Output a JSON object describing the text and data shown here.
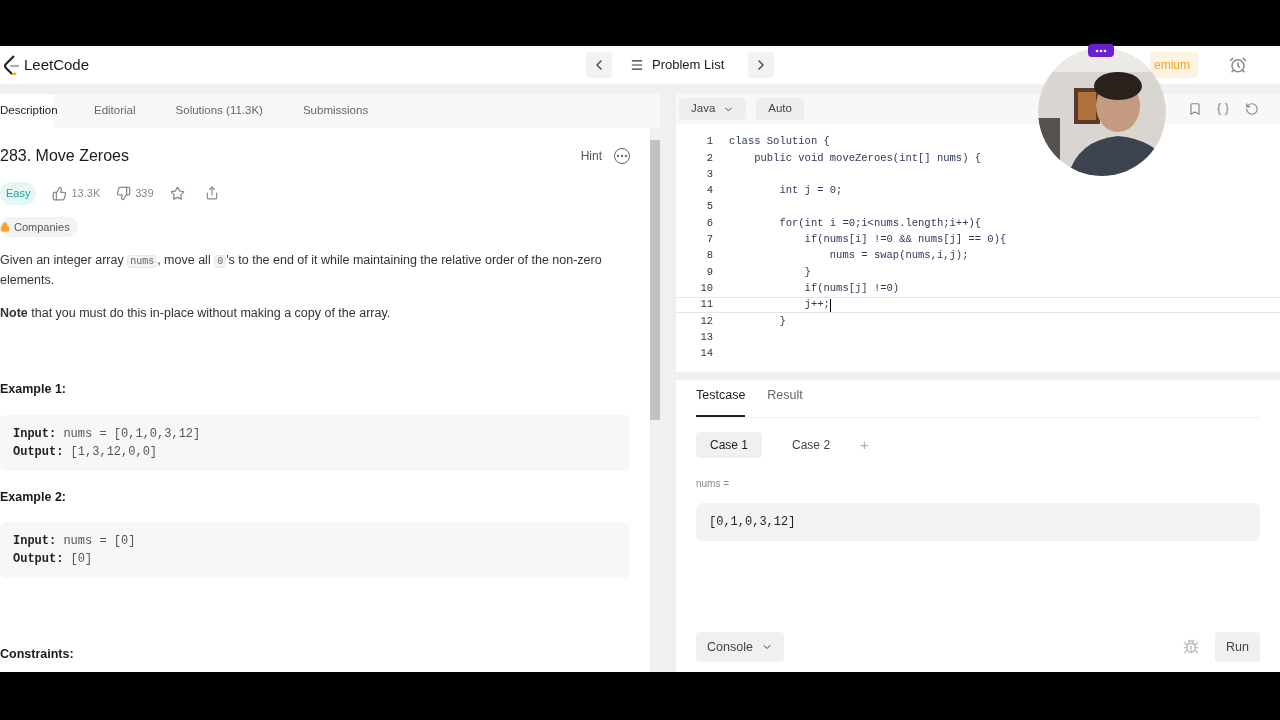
{
  "header": {
    "logo": "LeetCode",
    "nav_title": "Problem List",
    "premium": "emium"
  },
  "tabs": [
    {
      "label": "Description",
      "selected": true
    },
    {
      "label": "Editorial",
      "selected": false
    },
    {
      "label": "Solutions (11.3K)",
      "selected": false
    },
    {
      "label": "Submissions",
      "selected": false
    }
  ],
  "problem": {
    "title": "283. Move Zeroes",
    "hint": "Hint",
    "difficulty": "Easy",
    "likes": "13.3K",
    "dislikes": "339",
    "companies": "Companies",
    "paragraph": [
      {
        "text": "Given an integer array ",
        "code": false
      },
      {
        "text": "nums",
        "code": true
      },
      {
        "text": ", move all ",
        "code": false
      },
      {
        "text": "0",
        "code": true
      },
      {
        "text": "'s to the end of it while maintaining the relative order of the non-zero elements.",
        "code": false
      }
    ],
    "note": "**Note** that you must do this in-place without making a copy of the array.",
    "examples": [
      {
        "title": "Example 1:",
        "lines": [
          "**Input:** nums = [0,1,0,3,12]",
          "**Output:** [1,3,12,0,0]"
        ]
      },
      {
        "title": "Example 2:",
        "lines": [
          "**Input:** nums = [0]",
          "**Output:** [0]"
        ]
      }
    ],
    "constraints_title": "Constraints:"
  },
  "editor": {
    "language": "Java",
    "mode": "Auto",
    "lines": [
      {
        "n": "1",
        "text": "class Solution {",
        "current": false
      },
      {
        "n": "2",
        "text": "    public void moveZeroes(int[] nums) {",
        "current": false
      },
      {
        "n": "3",
        "current": false
      },
      {
        "n": "4",
        "text": "        int j = 0;",
        "current": false
      },
      {
        "n": "5",
        "current": false
      },
      {
        "n": "6",
        "text": "        for(int i =0;i<nums.length;i++){",
        "current": false
      },
      {
        "n": "7",
        "text": "            if(nums[i] !=0 && nums[j] == 0){",
        "current": false
      },
      {
        "n": "8",
        "text": "                nums = swap(nums,i,j);",
        "current": false
      },
      {
        "n": "9",
        "text": "            }",
        "current": false
      },
      {
        "n": "10",
        "text": "            if(nums[j] !=0)",
        "current": false
      },
      {
        "n": "11",
        "text": "            j++;",
        "current": true
      },
      {
        "n": "12",
        "text": "        }",
        "current": false
      },
      {
        "n": "13",
        "current": false
      },
      {
        "n": "14",
        "current": false
      }
    ]
  },
  "test_panel": {
    "tabs": [
      {
        "label": "Testcase",
        "selected": true
      },
      {
        "label": "Result",
        "selected": false
      }
    ],
    "cases": [
      {
        "label": "Case 1",
        "selected": true
      },
      {
        "label": "Case 2",
        "selected": false
      }
    ],
    "add": "+",
    "input_label": "nums =",
    "input_value": "[0,1,0,3,12]",
    "console": "Console",
    "run": "Run"
  }
}
